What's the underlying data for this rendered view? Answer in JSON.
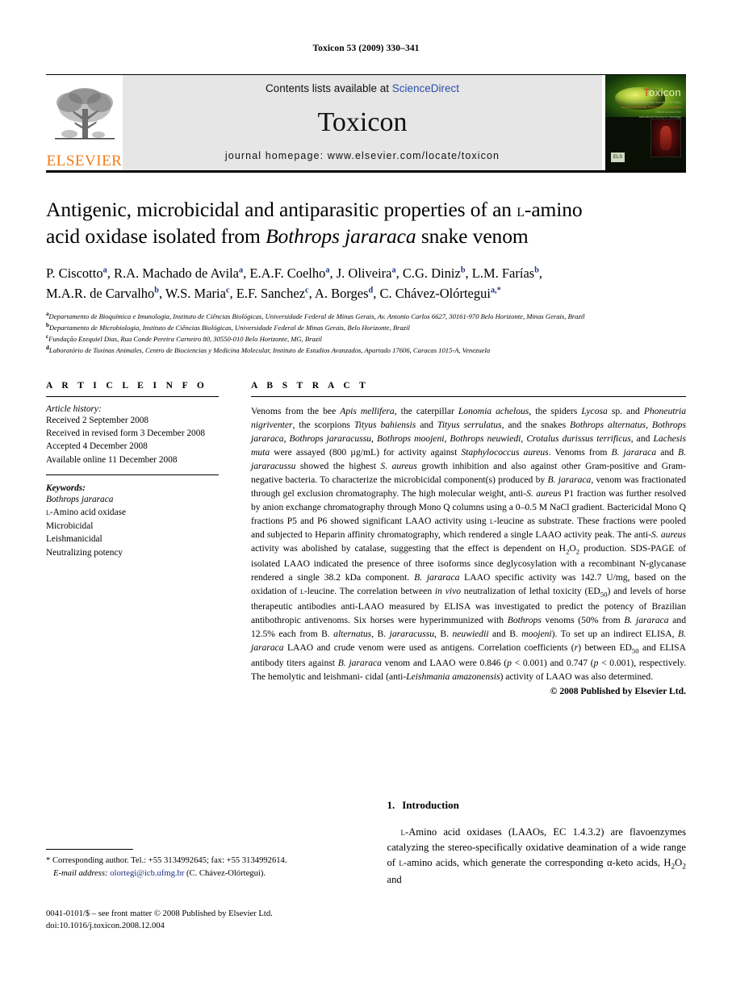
{
  "running_head": "Toxicon 53 (2009) 330–341",
  "banner": {
    "publisher": "ELSEVIER",
    "contents_prefix": "Contents lists available at ",
    "contents_link": "ScienceDirect",
    "journal_name": "Toxicon",
    "homepage": "journal homepage: www.elsevier.com/locate/toxicon",
    "cover": {
      "title": "Toxicon",
      "subtitle_lines": [
        "An Interdisciplinary Journal on the Toxins",
        "derived from Animals, Plants and Microorganisms",
        "Official Journal of the",
        "International Society on Toxinology",
        "www.elsevier.com/locate/toxicon"
      ],
      "publisher_mark": "ELS"
    }
  },
  "article": {
    "title_line1_a": "Antigenic, microbicidal and antiparasitic properties of an ",
    "title_smallcaps": "l",
    "title_line1_b": "-amino",
    "title_line2_a": "acid oxidase isolated from ",
    "title_italic": "Bothrops jararaca",
    "title_line2_b": " snake venom",
    "authors": [
      {
        "name": "P. Ciscotto",
        "sup": "a"
      },
      {
        "name": "R.A. Machado de Avila",
        "sup": "a"
      },
      {
        "name": "E.A.F. Coelho",
        "sup": "a"
      },
      {
        "name": "J. Oliveira",
        "sup": "a"
      },
      {
        "name": "C.G. Diniz",
        "sup": "b"
      },
      {
        "name": "L.M. Farías",
        "sup": "b"
      },
      {
        "name": "M.A.R. de Carvalho",
        "sup": "b"
      },
      {
        "name": "W.S. Maria",
        "sup": "c"
      },
      {
        "name": "E.F. Sanchez",
        "sup": "c"
      },
      {
        "name": "A. Borges",
        "sup": "d"
      },
      {
        "name": "C. Chávez-Olórtegui",
        "sup": "a,*"
      }
    ],
    "affiliations": [
      {
        "mark": "a",
        "text": "Departamento de Bioquímica e Imunologia, Instituto de Ciências Biológicas, Universidade Federal de Minas Gerais, Av. Antonio Carlos 6627, 30161-970 Belo Horizonte, Minas Gerais, Brazil"
      },
      {
        "mark": "b",
        "text": "Departamento de Microbiologia, Instituto de Ciências Biológicas, Universidade Federal de Minas Gerais, Belo Horizonte, Brazil"
      },
      {
        "mark": "c",
        "text": "Fundação Ezequiel Dias, Rua Conde Pereira Carneiro 80, 30550-010 Belo Horizonte, MG, Brazil"
      },
      {
        "mark": "d",
        "text": "Laboratório de Toxinas Animales, Centro de Biociencias y Medicina Molecular, Instituto de Estudios Avanzados, Apartado 17606, Caracas 1015-A, Venezuela"
      }
    ]
  },
  "article_info": {
    "heading": "A R T I C L E  I N F O",
    "history_label": "Article history:",
    "history": [
      "Received 2 September 2008",
      "Received in revised form 3 December 2008",
      "Accepted 4 December 2008",
      "Available online 11 December 2008"
    ],
    "keywords_label": "Keywords:",
    "keywords": [
      "Bothrops jararaca",
      "l-Amino acid oxidase",
      "Microbicidal",
      "Leishmanicidal",
      "Neutralizing potency"
    ]
  },
  "abstract": {
    "heading": "A B S T R A C T",
    "copyright": "© 2008 Published by Elsevier Ltd.",
    "paragraph": "Venoms from the bee Apis mellifera, the caterpillar Lonomia achelous, the spiders Lycosa sp. and Phoneutria nigriventer, the scorpions Tityus bahiensis and Tityus serrulatus, and the snakes Bothrops alternatus, Bothrops jararaca, Bothrops jararacussu, Bothrops moojeni, Bothrops neuwiedi, Crotalus durissus terrificus, and Lachesis muta were assayed (800 µg/mL) for activity against Staphylococcus aureus. Venoms from B. jararaca and B. jararacussu showed the highest S. aureus growth inhibition and also against other Gram-positive and Gram-negative bacteria. To characterize the microbicidal component(s) produced by B. jararaca, venom was fractionated through gel exclusion chromatography. The high molecular weight, anti-S. aureus P1 fraction was further resolved by anion exchange chromatography through Mono Q columns using a 0–0.5 M NaCl gradient. Bactericidal Mono Q fractions P5 and P6 showed significant LAAO activity using l-leucine as substrate. These fractions were pooled and subjected to Heparin affinity chromatography, which rendered a single LAAO activity peak. The anti-S. aureus activity was abolished by catalase, suggesting that the effect is dependent on H2O2 production. SDS-PAGE of isolated LAAO indicated the presence of three isoforms since deglycosylation with a recombinant N-glycanase rendered a single 38.2 kDa component. B. jararaca LAAO specific activity was 142.7 U/mg, based on the oxidation of l-leucine. The correlation between in vivo neutralization of lethal toxicity (ED50) and levels of horse therapeutic antibodies anti-LAAO measured by ELISA was investigated to predict the potency of Brazilian antibothropic antivenoms. Six horses were hyperimmunized with Bothrops venoms (50% from B. jararaca and 12.5% each from B. alternatus, B. jararacussu, B. neuwiedii and B. moojeni). To set up an indirect ELISA, B. jararaca LAAO and crude venom were used as antigens. Correlation coefficients (r) between ED50 and ELISA antibody titers against B. jararaca venom and LAAO were 0.846 (p < 0.001) and 0.747 (p < 0.001), respectively. The hemolytic and leishmanicidal (anti-Leishmania amazonensis) activity of LAAO was also determined."
  },
  "footnote": {
    "star": "*",
    "corresponding": "Corresponding author. Tel.: +55 3134992645; fax: +55 3134992614.",
    "email_label": "E-mail address:",
    "email": "olortegi@icb.ufmg.br",
    "email_suffix": "(C. Chávez-Olórtegui)."
  },
  "footer": {
    "issn_line": "0041-0101/$ – see front matter © 2008 Published by Elsevier Ltd.",
    "doi_line": "doi:10.1016/j.toxicon.2008.12.004"
  },
  "introduction": {
    "number": "1.",
    "heading": "Introduction",
    "text_a": "-Amino acid oxidases (LAAOs, EC 1.4.3.2) are flavoenzymes catalyzing the stereo-specifically oxidative deamination of a wide range of ",
    "sc_1": "l",
    "sc_2": "l",
    "text_b": "-amino acids, which generate the corresponding α-keto acids, H",
    "sub": "2",
    "text_c": "O",
    "sub2": "2",
    "text_d": " and"
  }
}
